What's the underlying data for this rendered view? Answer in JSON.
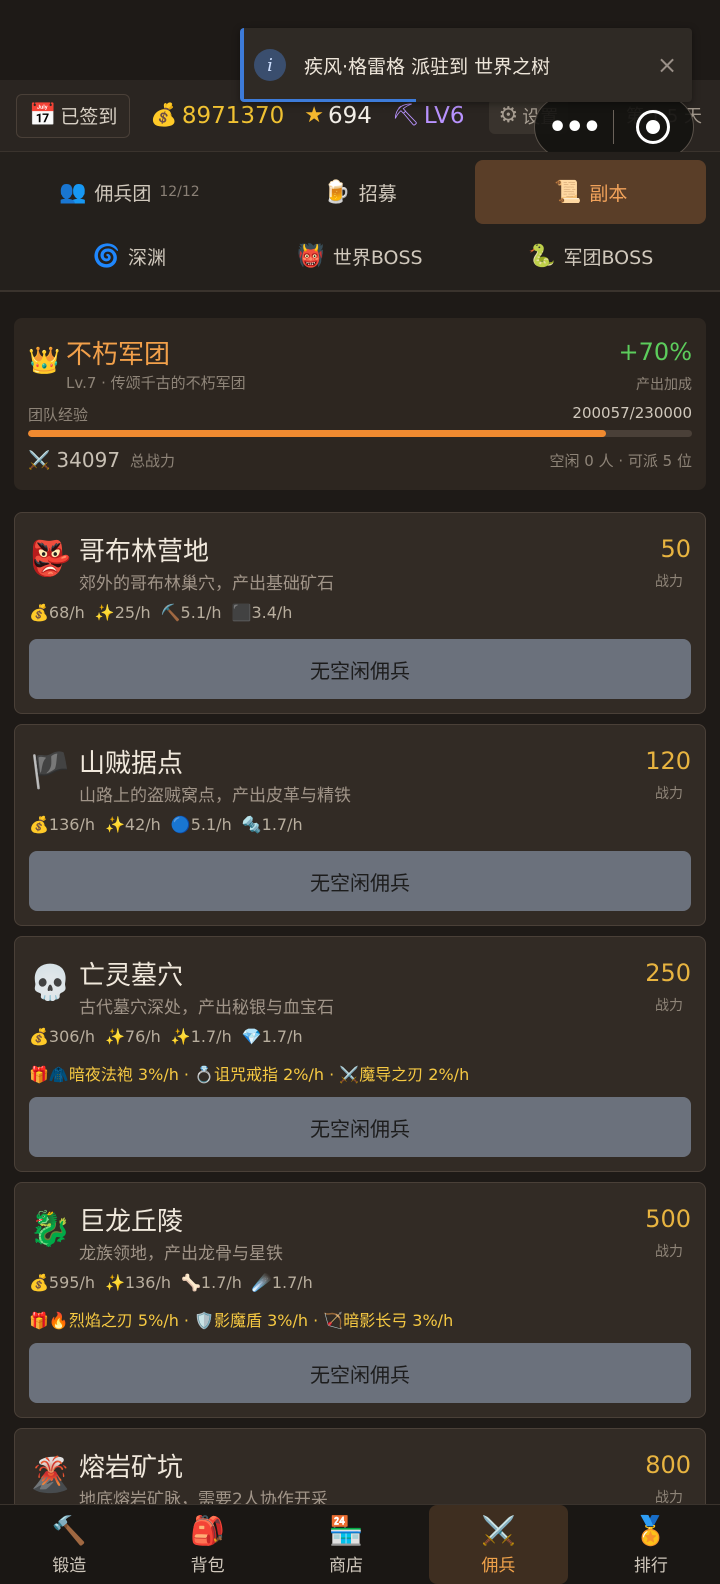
{
  "toast": {
    "message": "疾风·格雷格 派驻到 世界之树",
    "info_icon": "i",
    "close_icon": "×"
  },
  "topbar": {
    "signed_label": "已签到",
    "gold": "8971370",
    "stars": "694",
    "level": "LV6",
    "settings_label": "设置",
    "day_text": "第 1 5 天"
  },
  "tabs": {
    "row1": [
      {
        "label": "佣兵团",
        "sub": "12/12"
      },
      {
        "label": "招募"
      },
      {
        "label": "副本"
      }
    ],
    "row2": [
      {
        "label": "深渊"
      },
      {
        "label": "世界BOSS"
      },
      {
        "label": "军团BOSS"
      }
    ]
  },
  "team": {
    "name": "不朽军团",
    "desc": "Lv.7 · 传颂千古的不朽军团",
    "bonus": "+70%",
    "bonus_label": "产出加成",
    "exp_label": "团队经验",
    "exp_value": "200057/230000",
    "exp_fraction": 0.8698,
    "power": "34097",
    "power_label": "总战力",
    "idle_text": "空闲 0 人 · 可派 5 位"
  },
  "dungeons": [
    {
      "name": "哥布林营地",
      "desc": "郊外的哥布林巢穴，产出基础矿石",
      "power": "50",
      "power_label": "战力",
      "rates": [
        "💰68/h",
        "✨25/h",
        "⛏️5.1/h",
        "⬛3.4/h"
      ],
      "drops": "",
      "button": "无空闲佣兵"
    },
    {
      "name": "山贼据点",
      "desc": "山路上的盗贼窝点，产出皮革与精铁",
      "power": "120",
      "power_label": "战力",
      "rates": [
        "💰136/h",
        "✨42/h",
        "🔵5.1/h",
        "🔩1.7/h"
      ],
      "drops": "",
      "button": "无空闲佣兵"
    },
    {
      "name": "亡灵墓穴",
      "desc": "古代墓穴深处，产出秘银与血宝石",
      "power": "250",
      "power_label": "战力",
      "rates": [
        "💰306/h",
        "✨76/h",
        "✨1.7/h",
        "💎1.7/h"
      ],
      "drops": "🎁🧥暗夜法袍 3%/h · 💍诅咒戒指 2%/h · ⚔️魔导之刃 2%/h",
      "button": "无空闲佣兵"
    },
    {
      "name": "巨龙丘陵",
      "desc": "龙族领地，产出龙骨与星铁",
      "power": "500",
      "power_label": "战力",
      "rates": [
        "💰595/h",
        "✨136/h",
        "🦴1.7/h",
        "☄️1.7/h"
      ],
      "drops": "🎁🔥烈焰之刃 5%/h · 🛡️影魔盾 3%/h · 🏹暗影长弓 3%/h",
      "button": "无空闲佣兵"
    },
    {
      "name": "熔岩矿坑",
      "desc": "地底熔岩矿脉，需要2人协作开采",
      "power": "800",
      "power_label": "战力",
      "rates": [],
      "drops": "",
      "button": ""
    }
  ],
  "nav": [
    {
      "label": "锻造",
      "icon": "hammer-icon"
    },
    {
      "label": "背包",
      "icon": "backpack-icon"
    },
    {
      "label": "商店",
      "icon": "shop-icon"
    },
    {
      "label": "佣兵",
      "icon": "swords-icon"
    },
    {
      "label": "排行",
      "icon": "medal-icon"
    }
  ]
}
